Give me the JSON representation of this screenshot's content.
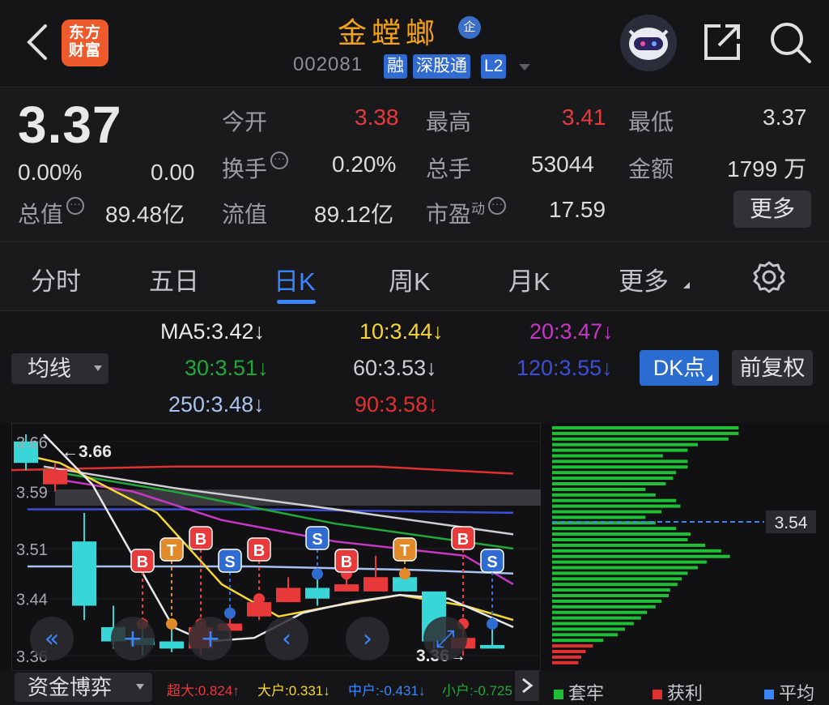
{
  "header": {
    "logo_line1": "东方",
    "logo_line2": "财富",
    "stock_name": "金螳螂",
    "qi_badge": "企",
    "code": "002081",
    "tags": [
      "融",
      "深股通",
      "L2"
    ]
  },
  "quote": {
    "price": "3.37",
    "change_pct": "0.00%",
    "change": "0.00",
    "open_label": "今开",
    "open": "3.38",
    "high_label": "最高",
    "high": "3.41",
    "low_label": "最低",
    "low": "3.37",
    "turnover_label": "换手",
    "turnover": "0.20%",
    "volume_label": "总手",
    "volume": "53044",
    "amount_label": "金额",
    "amount": "1799 万",
    "mktcap_label": "总值",
    "mktcap": "89.48亿",
    "float_label": "流值",
    "float_cap": "89.12亿",
    "pe_label": "市盈",
    "pe_super": "动",
    "pe": "17.59",
    "more_button": "更多"
  },
  "tabs": [
    "分时",
    "五日",
    "日K",
    "周K",
    "月K",
    "更多"
  ],
  "active_tab": "日K",
  "ma": {
    "selector": "均线",
    "ma5": "MA5:3.42↓",
    "ma10": "10:3.44↓",
    "ma20": "20:3.47↓",
    "ma30": "30:3.51↓",
    "ma60": "60:3.53↓",
    "ma120": "120:3.55↓",
    "ma250": "250:3.48↓",
    "ma90": "90:3.58↓",
    "dk_button": "DK点",
    "fuquan_button": "前复权",
    "colors": {
      "ma5": "#e9e9eb",
      "ma10": "#f5d634",
      "ma20": "#c637c6",
      "ma30": "#22a83a",
      "ma60": "#cfcfd3",
      "ma120": "#3d4fd8",
      "ma250": "#a9c3f0",
      "ma90": "#e03030"
    }
  },
  "chart_data": {
    "type": "candlestick",
    "y_ticks": [
      "3.66",
      "3.59",
      "3.51",
      "3.44",
      "3.36"
    ],
    "ylim": [
      3.35,
      3.67
    ],
    "max_label": "3.66",
    "min_label": "3.36",
    "candles": [
      {
        "o": 3.66,
        "c": 3.63,
        "h": 3.67,
        "l": 3.62,
        "up": false
      },
      {
        "o": 3.6,
        "c": 3.62,
        "h": 3.63,
        "l": 3.59,
        "up": true
      },
      {
        "o": 3.43,
        "c": 3.52,
        "h": 3.56,
        "l": 3.41,
        "up": false
      },
      {
        "o": 3.38,
        "c": 3.4,
        "h": 3.43,
        "l": 3.37,
        "up": false
      },
      {
        "o": 3.375,
        "c": 3.385,
        "h": 3.4,
        "l": 3.36,
        "up": false
      },
      {
        "o": 3.37,
        "c": 3.38,
        "h": 3.4,
        "l": 3.365,
        "up": false
      },
      {
        "o": 3.37,
        "c": 3.4,
        "h": 3.4,
        "l": 3.36,
        "up": true
      },
      {
        "o": 3.395,
        "c": 3.405,
        "h": 3.415,
        "l": 3.385,
        "up": true
      },
      {
        "o": 3.415,
        "c": 3.435,
        "h": 3.435,
        "l": 3.41,
        "up": true
      },
      {
        "o": 3.435,
        "c": 3.455,
        "h": 3.47,
        "l": 3.435,
        "up": true
      },
      {
        "o": 3.44,
        "c": 3.455,
        "h": 3.47,
        "l": 3.43,
        "up": false
      },
      {
        "o": 3.45,
        "c": 3.46,
        "h": 3.47,
        "l": 3.45,
        "up": true
      },
      {
        "o": 3.45,
        "c": 3.47,
        "h": 3.5,
        "l": 3.45,
        "up": true
      },
      {
        "o": 3.47,
        "c": 3.45,
        "h": 3.47,
        "l": 3.45,
        "up": false
      },
      {
        "o": 3.45,
        "c": 3.38,
        "h": 3.45,
        "l": 3.37,
        "up": false
      },
      {
        "o": 3.37,
        "c": 3.385,
        "h": 3.4,
        "l": 3.36,
        "up": true
      },
      {
        "o": 3.37,
        "c": 3.375,
        "h": 3.4,
        "l": 3.37,
        "up": false
      }
    ],
    "signals": [
      {
        "i": 4,
        "kind": "B"
      },
      {
        "i": 5,
        "kind": "T"
      },
      {
        "i": 6,
        "kind": "B"
      },
      {
        "i": 7,
        "kind": "S"
      },
      {
        "i": 8,
        "kind": "B"
      },
      {
        "i": 10,
        "kind": "S"
      },
      {
        "i": 11,
        "kind": "B"
      },
      {
        "i": 13,
        "kind": "T"
      },
      {
        "i": 15,
        "kind": "B"
      },
      {
        "i": 16,
        "kind": "S"
      }
    ],
    "chip_price_label": "3.54",
    "chip_legend": [
      "套牢",
      "获利",
      "平均"
    ],
    "chip_colors": {
      "trapped": "#1fbf36",
      "profit": "#e03030",
      "avg": "#3a86ff"
    }
  },
  "fund_flow": {
    "selector": "资金博弈",
    "super": "超大:0.824↑",
    "large": "大户:0.331↓",
    "mid": "中户:-0.431↓",
    "small": "小户:-0.725"
  }
}
